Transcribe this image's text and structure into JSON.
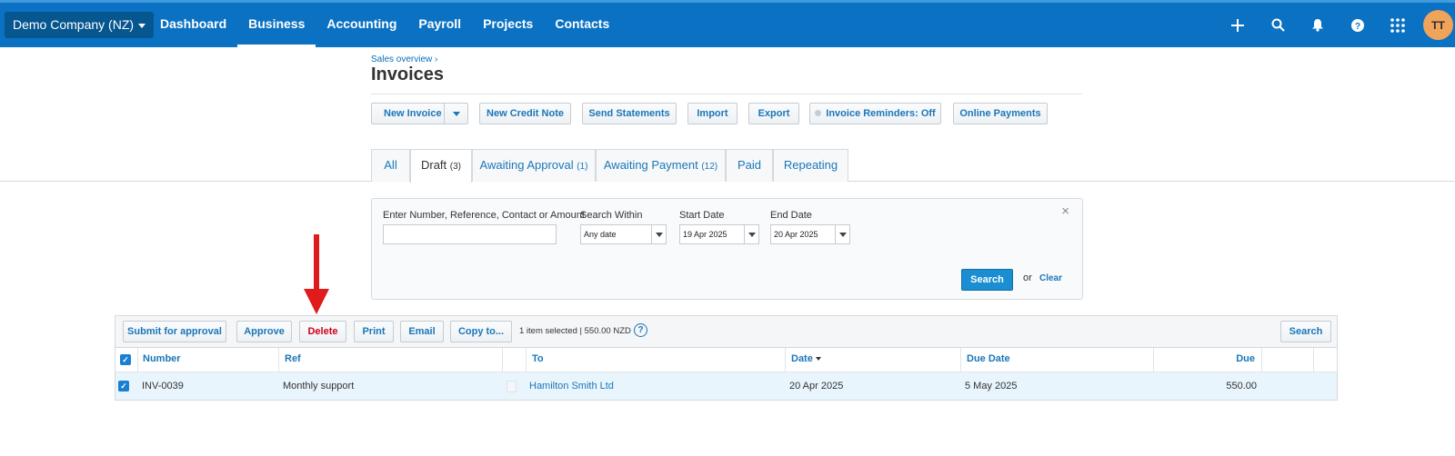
{
  "topbar": {
    "org": "Demo Company (NZ)",
    "nav": [
      "Dashboard",
      "Business",
      "Accounting",
      "Payroll",
      "Projects",
      "Contacts"
    ],
    "active_nav": "Business",
    "icons": [
      "plus-icon",
      "search-icon",
      "bell-icon",
      "help-icon",
      "apps-grid-icon"
    ],
    "avatar": "TT"
  },
  "page": {
    "breadcrumb": "Sales overview ›",
    "title": "Invoices"
  },
  "actions": {
    "new_invoice": "New Invoice",
    "new_credit_note": "New Credit Note",
    "send_statements": "Send Statements",
    "import": "Import",
    "export": "Export",
    "reminders": "Invoice Reminders: Off",
    "online_payments": "Online Payments"
  },
  "tabs": [
    {
      "label": "All",
      "count": ""
    },
    {
      "label": "Draft",
      "count": "(3)"
    },
    {
      "label": "Awaiting Approval",
      "count": "(1)"
    },
    {
      "label": "Awaiting Payment",
      "count": "(12)"
    },
    {
      "label": "Paid",
      "count": ""
    },
    {
      "label": "Repeating",
      "count": ""
    }
  ],
  "active_tab": "Draft",
  "filter": {
    "query_label": "Enter Number, Reference, Contact or Amount",
    "query_value": "",
    "within_label": "Search Within",
    "within_value": "Any date",
    "start_label": "Start Date",
    "start_value": "19 Apr 2025",
    "end_label": "End Date",
    "end_value": "20 Apr 2025",
    "search": "Search",
    "or": "or",
    "clear": "Clear",
    "close": "×"
  },
  "grid": {
    "toolbar": {
      "submit": "Submit for approval",
      "approve": "Approve",
      "delete": "Delete",
      "print": "Print",
      "email": "Email",
      "copy": "Copy to...",
      "selection": "1 item selected | 550.00 NZD",
      "help": "?",
      "search": "Search"
    },
    "headers": {
      "number": "Number",
      "ref": "Ref",
      "to": "To",
      "date": "Date",
      "due_date": "Due Date",
      "due": "Due"
    },
    "rows": [
      {
        "checked": true,
        "number": "INV-0039",
        "ref": "Monthly support",
        "to": "Hamilton Smith Ltd",
        "date": "20 Apr 2025",
        "due_date": "5 May 2025",
        "due": "550.00"
      }
    ]
  },
  "colors": {
    "brand": "#0b72c3",
    "accent_link": "#1a77b9",
    "delete": "#d0021b",
    "annotation_arrow": "#e01b1b"
  }
}
